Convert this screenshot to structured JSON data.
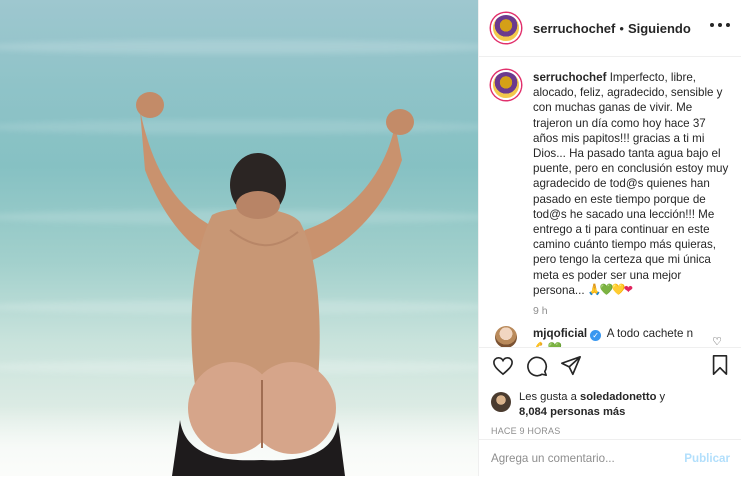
{
  "post": {
    "username": "serruchochef",
    "separator": "•",
    "follow_status": "Siguiendo",
    "caption": {
      "username": "serruchochef",
      "text": "Imperfecto, libre, alocado, feliz, agradecido, sensible y con muchas ganas de vivir. Me trajeron un día como hoy hace 37 años mis papitos!!! gracias a ti mi Dios... Ha pasado tanta agua bajo el puente, pero en conclusión estoy muy agradecido de tod@s quienes han pasado en este tiempo porque de tod@s he sacado una lección!!! Me entrego a ti para continuar en este camino cuánto tiempo más quieras, pero tengo la certeza que mi única meta es poder ser una mejor persona...",
      "emojis": [
        "🙏",
        "💚",
        "💛",
        "❤"
      ],
      "time": "9 h"
    },
    "comment": {
      "username": "mjqoficial",
      "verified_mark": "✓",
      "text": "A todo cachete n",
      "emojis": [
        "💪",
        "💚"
      ]
    },
    "likes": {
      "prefix": "Les gusta a",
      "user": "soledadonetto",
      "conjunction": "y",
      "count": "8,084 personas más"
    },
    "timestamp": "Hace 9 horas",
    "comment_input": {
      "placeholder": "Agrega un comentario..."
    },
    "publish_label": "Publicar"
  },
  "colors": {
    "link_blue": "#3897f0",
    "publish_disabled": "#b2dffc",
    "muted": "#8e8e8e",
    "text": "#262626"
  },
  "icons": [
    "more-icon",
    "heart-icon",
    "comment-icon",
    "share-icon",
    "bookmark-icon",
    "verified-icon"
  ]
}
